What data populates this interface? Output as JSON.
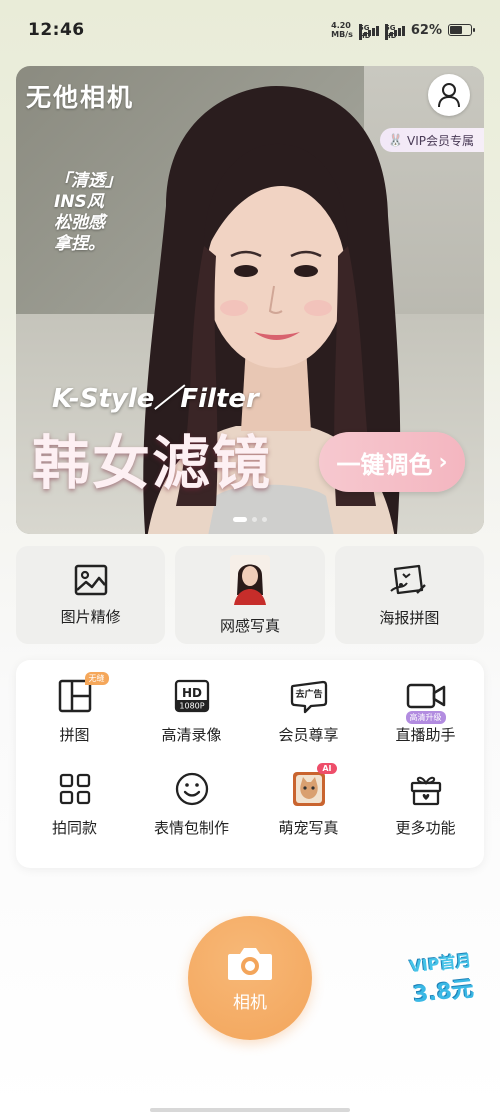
{
  "status_bar": {
    "time": "12:46",
    "net_speed_value": "4.20",
    "net_speed_unit": "MB/s",
    "signal1_label": "5G HD",
    "signal2_label": "5G HD",
    "battery_percent": "62%",
    "battery_level": 0.62
  },
  "banner": {
    "brand": "无他相机",
    "vip_tag": "VIP会员专属",
    "tagline": [
      "「清透」",
      "INS风",
      "松弛感",
      "拿捏。"
    ],
    "filter_en": "K-Style／Filter",
    "filter_cn": "韩女滤镜",
    "cta": "一键调色",
    "page_count": 3,
    "active_page": 1
  },
  "quick_cards": [
    {
      "label": "图片精修",
      "icon": "image-icon"
    },
    {
      "label": "网感写真",
      "icon": "portrait-thumbnail"
    },
    {
      "label": "海报拼图",
      "icon": "poster-icon"
    }
  ],
  "functions": [
    {
      "label": "拼图",
      "icon": "collage-icon",
      "badge": "无缝"
    },
    {
      "label": "高清录像",
      "icon": "hd-video-icon",
      "icon_text_top": "HD",
      "icon_text_bottom": "1080P"
    },
    {
      "label": "会员尊享",
      "icon": "no-ads-icon",
      "icon_text": "去广告"
    },
    {
      "label": "直播助手",
      "icon": "video-camera-icon",
      "badge": "高清升级"
    },
    {
      "label": "拍同款",
      "icon": "grid-icon"
    },
    {
      "label": "表情包制作",
      "icon": "smile-icon"
    },
    {
      "label": "萌宠写真",
      "icon": "pet-icon",
      "badge": "AI"
    },
    {
      "label": "更多功能",
      "icon": "gift-icon"
    }
  ],
  "camera": {
    "label": "相机"
  },
  "vip_promo": {
    "line1": "VIP首月",
    "line2": "3.8元"
  },
  "colors": {
    "accent": "#f3a55b",
    "vip_blue": "#3ab8e5",
    "card_bg": "#efefed"
  }
}
